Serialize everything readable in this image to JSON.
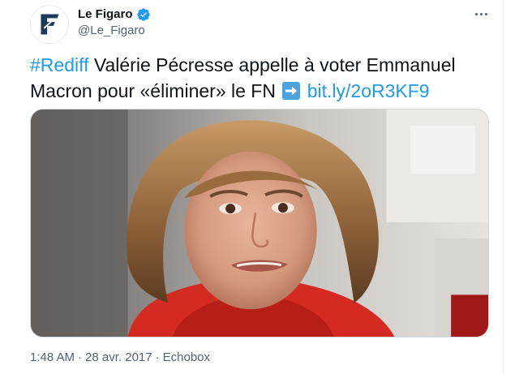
{
  "tweet": {
    "author": {
      "name": "Le Figaro",
      "handle": "@Le_Figaro",
      "avatar_icon": "le-figaro-logo",
      "verified": true
    },
    "text": {
      "hashtag": "#Rediff",
      "body": " Valérie Pécresse appelle à voter Emmanuel Macron pour «éliminer» le FN ",
      "emoji": "right-arrow-emoji",
      "link": "bit.ly/2oR3KF9"
    },
    "media": {
      "type": "photo"
    },
    "meta": {
      "time": "1:48 AM",
      "separator": "·",
      "date": "28 avr. 2017",
      "source": "Echobox"
    }
  },
  "colors": {
    "link": "#1d9bf0",
    "secondary_text": "#536471",
    "verified_badge": "#1d9bf0",
    "border": "#cfd9de"
  }
}
